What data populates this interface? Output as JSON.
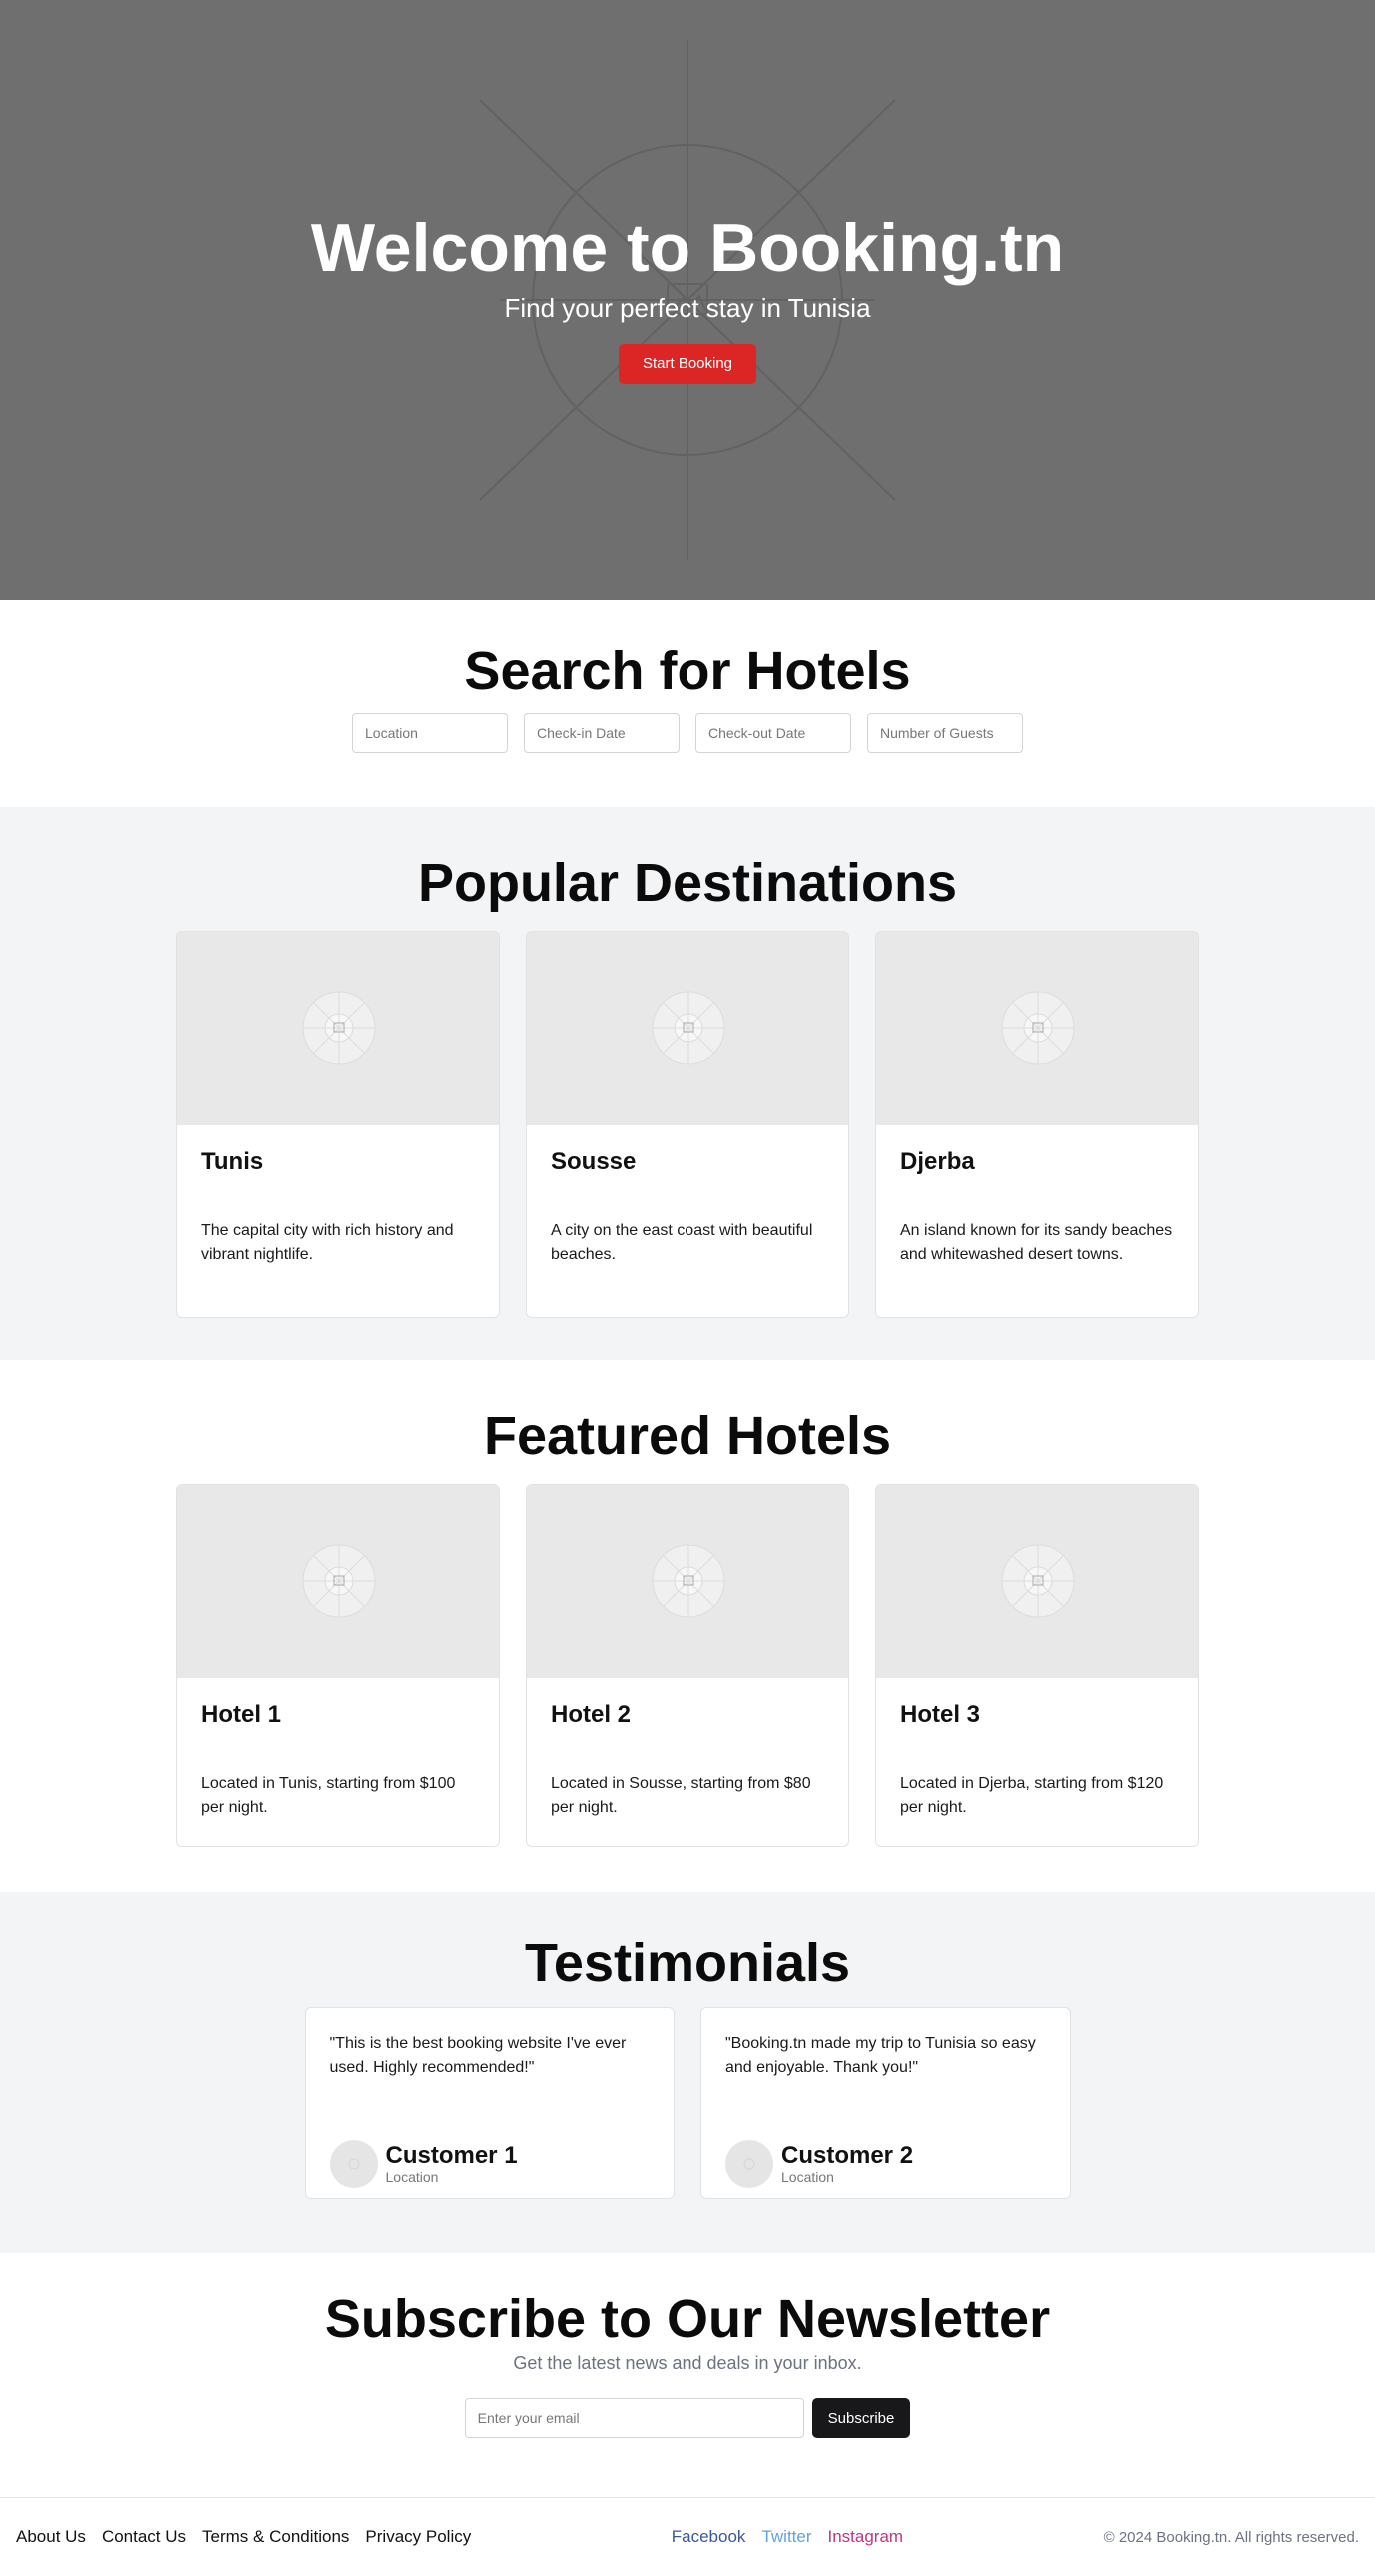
{
  "hero": {
    "title": "Welcome to Booking.tn",
    "subtitle": "Find your perfect stay in Tunisia",
    "button": "Start Booking"
  },
  "search": {
    "title": "Search for Hotels",
    "fields": [
      {
        "placeholder": "Location"
      },
      {
        "placeholder": "Check-in Date"
      },
      {
        "placeholder": "Check-out Date"
      },
      {
        "placeholder": "Number of Guests"
      }
    ]
  },
  "destinations": {
    "title": "Popular Destinations",
    "items": [
      {
        "name": "Tunis",
        "description": "The capital city with rich history and vibrant nightlife."
      },
      {
        "name": "Sousse",
        "description": "A city on the east coast with beautiful beaches."
      },
      {
        "name": "Djerba",
        "description": "An island known for its sandy beaches and whitewashed desert towns."
      }
    ]
  },
  "featured": {
    "title": "Featured Hotels",
    "items": [
      {
        "name": "Hotel 1",
        "description": "Located in Tunis, starting from $100 per night."
      },
      {
        "name": "Hotel 2",
        "description": "Located in Sousse, starting from $80 per night."
      },
      {
        "name": "Hotel 3",
        "description": "Located in Djerba, starting from $120 per night."
      }
    ]
  },
  "testimonials": {
    "title": "Testimonials",
    "items": [
      {
        "quote": "\"This is the best booking website I've ever used. Highly recommended!\"",
        "name": "Customer 1",
        "location": "Location"
      },
      {
        "quote": "\"Booking.tn made my trip to Tunisia so easy and enjoyable. Thank you!\"",
        "name": "Customer 2",
        "location": "Location"
      }
    ]
  },
  "newsletter": {
    "title": "Subscribe to Our Newsletter",
    "subtitle": "Get the latest news and deals in your inbox.",
    "placeholder": "Enter your email",
    "button": "Subscribe"
  },
  "footer": {
    "links": [
      "About Us",
      "Contact Us",
      "Terms & Conditions",
      "Privacy Policy"
    ],
    "social": [
      {
        "label": "Facebook",
        "color": "#3b5998"
      },
      {
        "label": "Twitter",
        "color": "#5ba4e5"
      },
      {
        "label": "Instagram",
        "color": "#c13584"
      }
    ],
    "copyright": "© 2024 Booking.tn. All rights reserved."
  },
  "colors": {
    "accent": "#dc2626",
    "hero_bg": "#6f6f6f",
    "section_grey": "#f3f4f6",
    "dark_button": "#18181b"
  }
}
